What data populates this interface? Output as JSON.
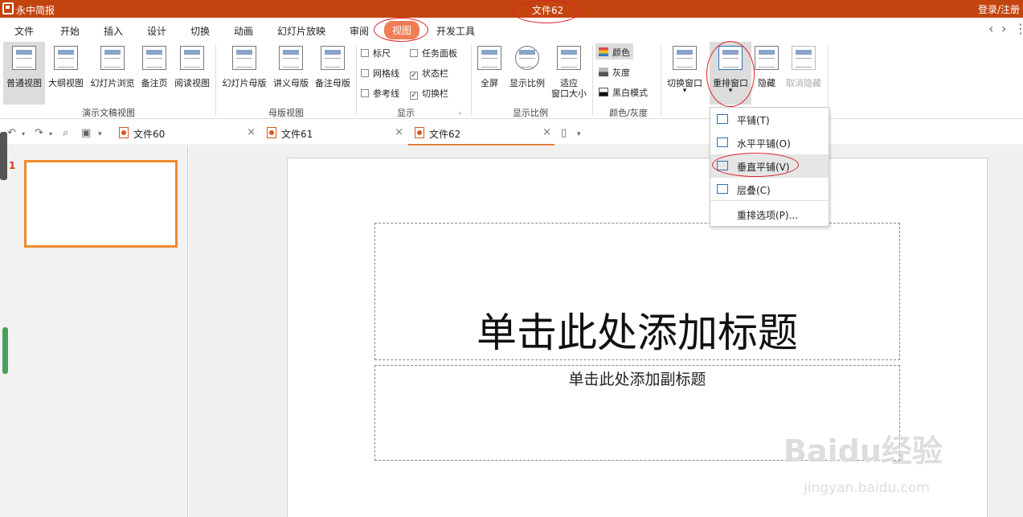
{
  "app": {
    "name": "永中简报",
    "document_title": "文件62",
    "login": "登录/注册"
  },
  "menu": {
    "items": [
      "文件",
      "开始",
      "插入",
      "设计",
      "切换",
      "动画",
      "幻灯片放映",
      "审阅",
      "视图",
      "开发工具"
    ],
    "active": "视图"
  },
  "ribbon": {
    "view_group": {
      "label": "演示文稿视图",
      "buttons": [
        "普通视图",
        "大纲视图",
        "幻灯片浏览",
        "备注页",
        "阅读视图"
      ]
    },
    "master_group": {
      "label": "母版视图",
      "buttons": [
        "幻灯片母版",
        "讲义母版",
        "备注母版"
      ]
    },
    "show_group": {
      "label": "显示",
      "checkboxes": [
        {
          "label": "标尺",
          "checked": false
        },
        {
          "label": "任务面板",
          "checked": false
        },
        {
          "label": "网格线",
          "checked": false
        },
        {
          "label": "状态栏",
          "checked": true
        },
        {
          "label": "参考线",
          "checked": false
        },
        {
          "label": "切换栏",
          "checked": true
        }
      ]
    },
    "zoom_group": {
      "label": "显示比例",
      "fullscreen": "全屏",
      "zoom": "显示比例",
      "fit_line1": "适应",
      "fit_line2": "窗口大小"
    },
    "color_group": {
      "label": "颜色/灰度",
      "color": "颜色",
      "gray": "灰度",
      "bw": "黑白模式"
    },
    "window_group": {
      "switch": "切换窗口",
      "arrange": "重排窗口",
      "hide": "隐藏",
      "unhide": "取消隐藏"
    }
  },
  "tabs": [
    "文件60",
    "文件61",
    "文件62"
  ],
  "active_tab": "文件62",
  "slide_panel": {
    "slide_number": "1"
  },
  "slide": {
    "title_placeholder": "单击此处添加标题",
    "subtitle_placeholder": "单击此处添加副标题"
  },
  "arrange_menu": {
    "items": [
      "平铺(T)",
      "水平平铺(O)",
      "垂直平铺(V)",
      "层叠(C)"
    ],
    "options": "重排选项(P)...",
    "highlighted": "垂直平铺(V)"
  },
  "watermark": {
    "brand": "Baidu经验",
    "url": "jingyan.baidu.com"
  },
  "colors": {
    "titlebar": "#c44410",
    "active_menu": "#ef7e55",
    "thumb_border": "#f0892e",
    "annotation": "#e0202a"
  }
}
